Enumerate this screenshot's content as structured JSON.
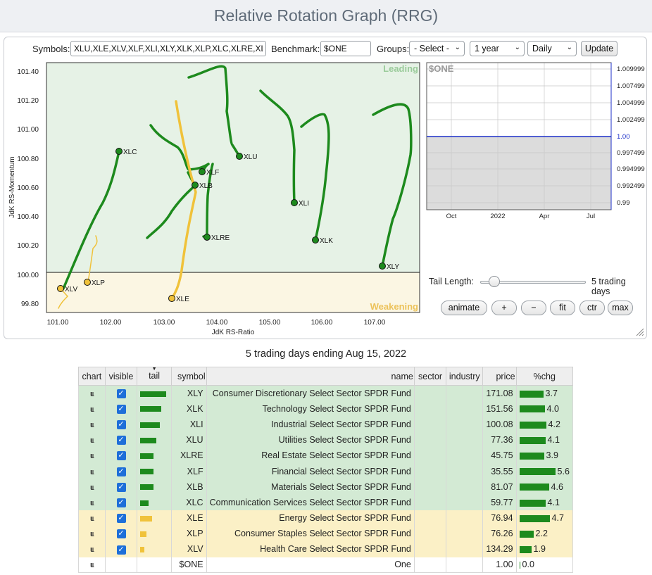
{
  "page": {
    "title": "Relative Rotation Graph (RRG)"
  },
  "controls": {
    "symbols_label": "Symbols:",
    "symbols_value": "XLU,XLE,XLV,XLF,XLI,XLY,XLK,XLP,XLC,XLRE,XLB",
    "benchmark_label": "Benchmark:",
    "benchmark_value": "$ONE",
    "groups_label": "Groups:",
    "groups_value": "- Select -",
    "period_value": "1 year",
    "frequency_value": "Daily",
    "update_label": "Update"
  },
  "rrg": {
    "xlabel": "JdK RS-Ratio",
    "ylabel": "JdK RS-Momentum",
    "x_ticks": [
      "101.00",
      "102.00",
      "103.00",
      "104.00",
      "105.00",
      "106.00",
      "107.00"
    ],
    "y_ticks": [
      "101.40",
      "101.20",
      "101.00",
      "100.80",
      "100.60",
      "100.40",
      "100.20",
      "100.00",
      "99.80"
    ],
    "quadrants": {
      "leading": "Leading",
      "weakening": "Weakening"
    },
    "symbols": [
      "XLC",
      "XLU",
      "XLF",
      "XLB",
      "XLI",
      "XLRE",
      "XLK",
      "XLY",
      "XLV",
      "XLP",
      "XLE"
    ]
  },
  "benchmark_chart": {
    "symbol": "$ONE",
    "y_ticks": [
      "1.0099999",
      "1.0074999",
      "1.0049999",
      "1.0024999",
      "1.00",
      "0.9974999",
      "0.9949999",
      "0.9924999",
      "0.99"
    ],
    "x_ticks": [
      "Oct",
      "2022",
      "Apr",
      "Jul"
    ]
  },
  "tail": {
    "label": "Tail Length:",
    "value": "5 trading days",
    "slider_fraction": 0.08
  },
  "buttons": {
    "animate": "animate",
    "plus": "+",
    "minus": "−",
    "fit": "fit",
    "ctr": "ctr",
    "max": "max"
  },
  "caption": "5 trading days ending Aug 15, 2022",
  "table": {
    "headers": [
      "chart",
      "visible",
      "tail",
      "symbol",
      "name",
      "sector",
      "industry",
      "price",
      "%chg"
    ],
    "rows": [
      {
        "symbol": "XLY",
        "name": "Consumer Discretionary Select Sector SPDR Fund",
        "price": "171.08",
        "chg": "3.7",
        "quadrant": "leading"
      },
      {
        "symbol": "XLK",
        "name": "Technology Select Sector SPDR Fund",
        "price": "151.56",
        "chg": "4.0",
        "quadrant": "leading"
      },
      {
        "symbol": "XLI",
        "name": "Industrial Select Sector SPDR Fund",
        "price": "100.08",
        "chg": "4.2",
        "quadrant": "leading"
      },
      {
        "symbol": "XLU",
        "name": "Utilities Select Sector SPDR Fund",
        "price": "77.36",
        "chg": "4.1",
        "quadrant": "leading"
      },
      {
        "symbol": "XLRE",
        "name": "Real Estate Select Sector SPDR Fund",
        "price": "45.75",
        "chg": "3.9",
        "quadrant": "leading"
      },
      {
        "symbol": "XLF",
        "name": "Financial Select Sector SPDR Fund",
        "price": "35.55",
        "chg": "5.6",
        "quadrant": "leading"
      },
      {
        "symbol": "XLB",
        "name": "Materials Select Sector SPDR Fund",
        "price": "81.07",
        "chg": "4.6",
        "quadrant": "leading"
      },
      {
        "symbol": "XLC",
        "name": "Communication Services Select Sector SPDR Fund",
        "price": "59.77",
        "chg": "4.1",
        "quadrant": "leading"
      },
      {
        "symbol": "XLE",
        "name": "Energy Select Sector SPDR Fund",
        "price": "76.94",
        "chg": "4.7",
        "quadrant": "weakening"
      },
      {
        "symbol": "XLP",
        "name": "Consumer Staples Select Sector SPDR Fund",
        "price": "76.26",
        "chg": "2.2",
        "quadrant": "weakening"
      },
      {
        "symbol": "XLV",
        "name": "Health Care Select Sector SPDR Fund",
        "price": "134.29",
        "chg": "1.9",
        "quadrant": "weakening"
      },
      {
        "symbol": "$ONE",
        "name": "One",
        "price": "1.00",
        "chg": "0.0",
        "quadrant": "none"
      }
    ]
  },
  "colors": {
    "leading_bg": "#e6f2e6",
    "weakening_bg": "#fbf6e3",
    "leading_tail": "#1d8a1d",
    "weakening_tail": "#f0c23a",
    "benchmark_line": "#1c2fc9"
  }
}
